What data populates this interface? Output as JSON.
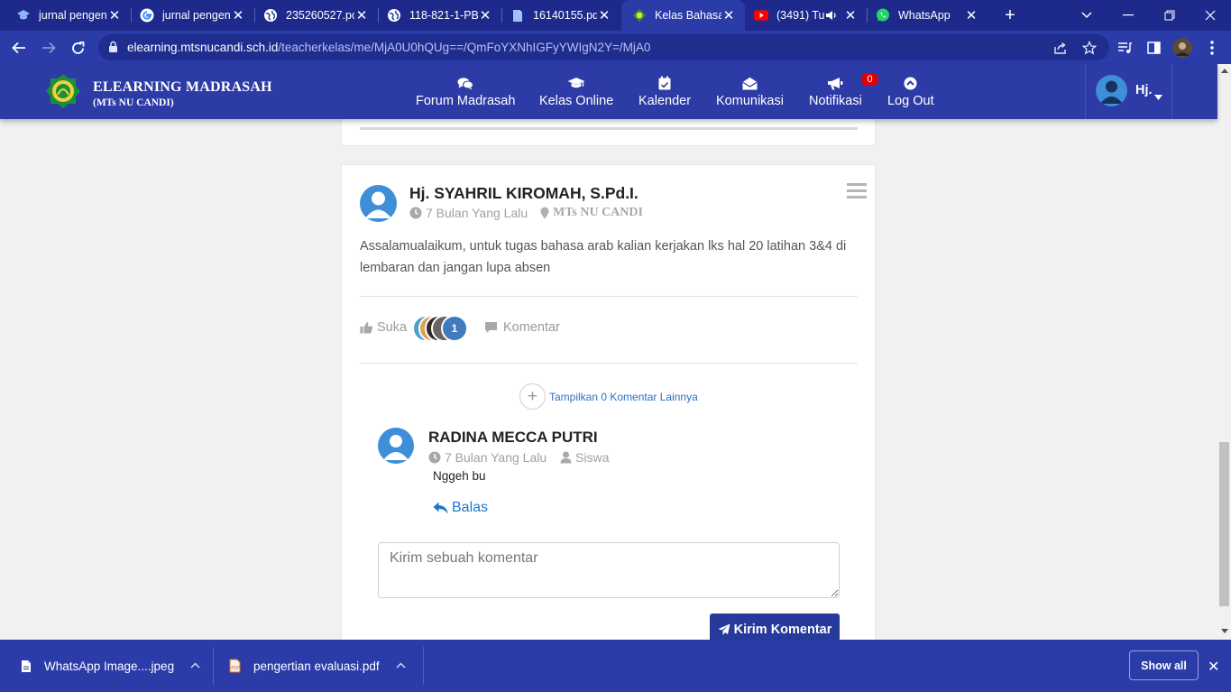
{
  "browser": {
    "tabs": [
      {
        "title": "jurnal pengen",
        "icon": "mortarboard-icon",
        "active": false
      },
      {
        "title": "jurnal pengen",
        "icon": "google-icon",
        "active": false
      },
      {
        "title": "235260527.pc",
        "icon": "globe-icon",
        "active": false
      },
      {
        "title": "118-821-1-PB",
        "icon": "globe-icon",
        "active": false
      },
      {
        "title": "16140155.pdf",
        "icon": "file-icon",
        "active": false
      },
      {
        "title": "Kelas Bahasa",
        "icon": "madrasah-logo-icon",
        "active": true
      },
      {
        "title": "(3491) Tu",
        "icon": "youtube-icon",
        "active": false
      },
      {
        "title": "WhatsApp",
        "icon": "whatsapp-icon",
        "active": false
      }
    ],
    "url_domain": "elearning.mtsnucandi.sch.id",
    "url_path": "/teacherkelas/me/MjA0U0hQUg==/QmFoYXNhIGFyYWIgN2Y=/MjA0"
  },
  "site": {
    "brand_title": "ELEARNING MADRASAH",
    "brand_subtitle": "(MTs NU CANDI)",
    "nav": [
      {
        "label": "Forum Madrasah",
        "icon": "comments-icon"
      },
      {
        "label": "Kelas Online",
        "icon": "graduation-cap-icon"
      },
      {
        "label": "Kalender",
        "icon": "calendar-icon"
      },
      {
        "label": "Komunikasi",
        "icon": "envelope-open-icon"
      },
      {
        "label": "Notifikasi",
        "icon": "bullhorn-icon"
      },
      {
        "label": "Log Out",
        "icon": "chevron-up-circle-icon"
      }
    ],
    "notification_count": "0",
    "user_label": "Hj."
  },
  "post": {
    "author": "Hj. SYAHRIL KIROMAH, S.Pd.I.",
    "time": "7 Bulan Yang Lalu",
    "location": "MTs NU CANDI",
    "body": "Assalamualaikum, untuk tugas bahasa arab kalian kerjakan lks hal 20 latihan 3&4 di lembaran dan jangan lupa absen",
    "like_label": "Suka",
    "like_count": "1",
    "comment_label": "Komentar",
    "show_more_comments": "Tampilkan 0 Komentar Lainnya"
  },
  "comment": {
    "author": "RADINA MECCA PUTRI",
    "time": "7 Bulan Yang Lalu",
    "role": "Siswa",
    "text": "Nggeh bu",
    "reply_label": "Balas"
  },
  "comment_form": {
    "placeholder": "Kirim sebuah komentar",
    "submit_label": "Kirim Komentar"
  },
  "downloads": {
    "items": [
      {
        "name": "WhatsApp Image....jpeg",
        "icon": "file-icon"
      },
      {
        "name": "pengertian evaluasi.pdf",
        "icon": "pdf-icon"
      }
    ],
    "show_all_label": "Show all"
  },
  "colors": {
    "chrome": "#2b3ba8",
    "header": "#2c3ba6",
    "link": "#1f76d2",
    "submit": "#263a9c",
    "badge": "#e00000"
  }
}
